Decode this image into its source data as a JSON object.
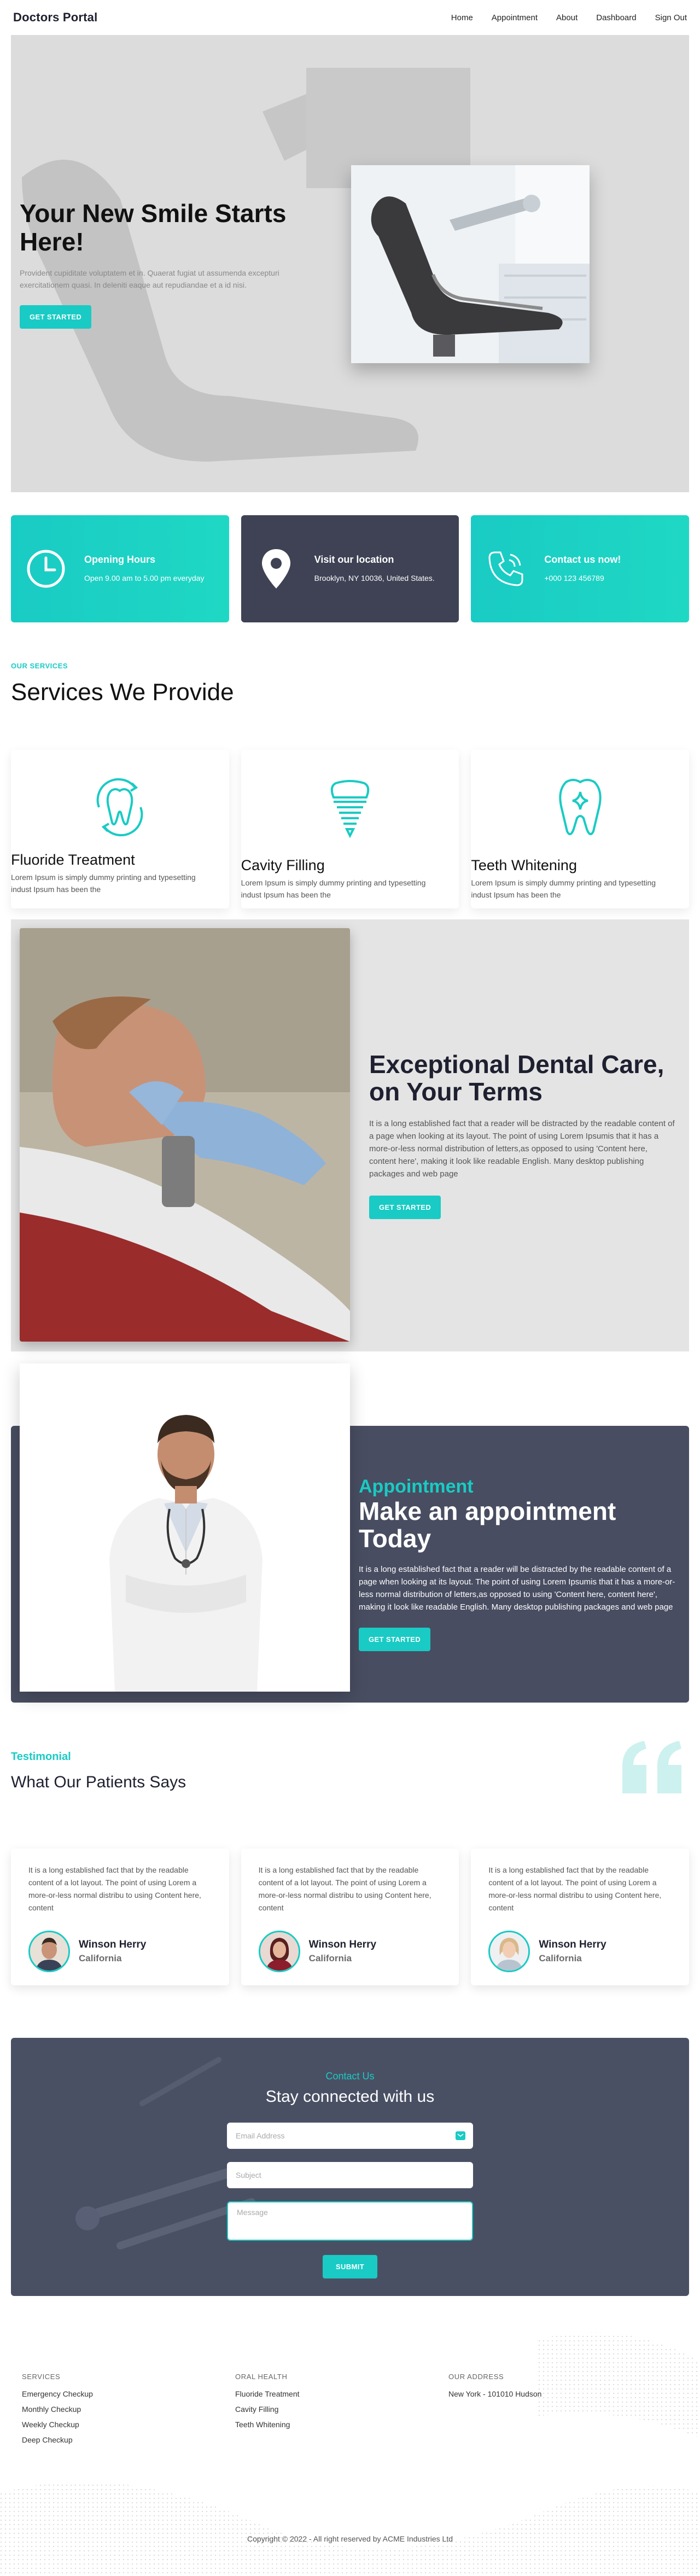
{
  "nav": {
    "brand": "Doctors Portal",
    "links": [
      "Home",
      "Appointment",
      "About",
      "Dashboard",
      "Sign Out"
    ]
  },
  "hero": {
    "title": "Your New Smile Starts Here!",
    "subtitle": "Provident cupiditate voluptatem et in. Quaerat fugiat ut assumenda excepturi exercitationem quasi. In deleniti eaque aut repudiandae et a id nisi.",
    "button": "GET STARTED"
  },
  "info_cards": [
    {
      "title": "Opening Hours",
      "text": "Open 9.00 am to 5.00 pm everyday",
      "icon": "clock-icon"
    },
    {
      "title": "Visit our location",
      "text": "Brooklyn, NY 10036, United States.",
      "icon": "map-pin-icon"
    },
    {
      "title": "Contact us now!",
      "text": "+000 123 456789",
      "icon": "phone-icon"
    }
  ],
  "services": {
    "kicker": "OUR SERVICES",
    "title": "Services We Provide",
    "items": [
      {
        "name": "Fluoride Treatment",
        "desc": "Lorem Ipsum is simply dummy printing and typesetting indust Ipsum has been the",
        "icon": "tooth-refresh-icon"
      },
      {
        "name": "Cavity Filling",
        "desc": "Lorem Ipsum is simply dummy printing and typesetting indust Ipsum has been the",
        "icon": "tooth-implant-icon"
      },
      {
        "name": "Teeth Whitening",
        "desc": "Lorem Ipsum is simply dummy printing and typesetting indust Ipsum has been the",
        "icon": "tooth-sparkle-icon"
      }
    ]
  },
  "exceptional": {
    "title": "Exceptional Dental Care, on Your Terms",
    "body": "It is a long established fact that a reader will be distracted by the readable content of a page when looking at its layout. The point of using Lorem Ipsumis that it has a more-or-less normal distribution of letters,as opposed to using 'Content here, content here', making it look like readable English. Many desktop publishing packages and web page",
    "button": "GET STARTED"
  },
  "appointment": {
    "kicker": "Appointment",
    "title": "Make an appointment Today",
    "body": "It is a long established fact that a reader will be distracted by the readable content of a page when looking at its layout. The point of using Lorem Ipsumis that it has a more-or-less normal distribution of letters,as opposed to using 'Content here, content here', making it look like readable English. Many desktop publishing packages and web page",
    "button": "GET STARTED"
  },
  "testimonial": {
    "kicker": "Testimonial",
    "title": "What Our Patients Says",
    "items": [
      {
        "text": "It is a long established fact that by the readable content of a lot layout. The point of using Lorem a more-or-less normal distribu to using Content here, content",
        "name": "Winson Herry",
        "location": "California"
      },
      {
        "text": "It is a long established fact that by the readable content of a lot layout. The point of using Lorem a more-or-less normal distribu to using Content here, content",
        "name": "Winson Herry",
        "location": "California"
      },
      {
        "text": "It is a long established fact that by the readable content of a lot layout. The point of using Lorem a more-or-less normal distribu to using Content here, content",
        "name": "Winson Herry",
        "location": "California"
      }
    ]
  },
  "contact": {
    "kicker": "Contact Us",
    "title": "Stay connected with us",
    "email_placeholder": "Email Address",
    "subject_placeholder": "Subject",
    "message_placeholder": "Message",
    "button": "SUBMIT"
  },
  "footer": {
    "columns": [
      {
        "title": "SERVICES",
        "items": [
          "Emergency Checkup",
          "Monthly Checkup",
          "Weekly Checkup",
          "Deep Checkup"
        ]
      },
      {
        "title": "ORAL HEALTH",
        "items": [
          "Fluoride Treatment",
          "Cavity Filling",
          "Teeth Whitening"
        ]
      },
      {
        "title": "OUR ADDRESS",
        "items": [
          "New York - 101010 Hudson"
        ]
      }
    ],
    "copyright": "Copyright © 2022 - All right reserved by ACME Industries Ltd"
  },
  "colors": {
    "accent": "#19cbc4",
    "dark": "#3e4254",
    "hero_bg": "#dcdcdc"
  }
}
